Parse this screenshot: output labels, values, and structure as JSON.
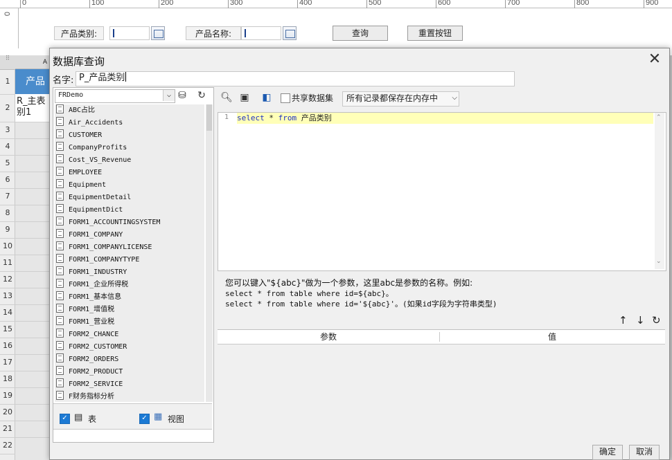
{
  "ruler": {
    "numbers": [
      "0",
      "100",
      "200",
      "300",
      "400",
      "500",
      "600",
      "700",
      "800",
      "900"
    ],
    "left_number": "0"
  },
  "form": {
    "label1": "产品类别:",
    "label2": "产品名称:",
    "query_button": "查询",
    "reset_button": "重置按钮"
  },
  "sheet": {
    "col_header": "A",
    "header_cell": "产品",
    "sub_cell": "R_主表别1",
    "row_numbers": [
      "1",
      "2",
      "3",
      "4",
      "5",
      "6",
      "7",
      "8",
      "9",
      "10",
      "11",
      "12",
      "13",
      "14",
      "15",
      "16",
      "17",
      "18",
      "19",
      "20",
      "21",
      "22"
    ]
  },
  "dialog": {
    "title": "数据库查询",
    "close_icon": "close-icon",
    "name_label": "名字:",
    "name_value": "P_产品类别",
    "datasource": "FRDemo",
    "tables": [
      "ABC占比",
      "Air_Accidents",
      "CUSTOMER",
      "CompanyProfits",
      "Cost_VS_Revenue",
      "EMPLOYEE",
      "Equipment",
      "EquipmentDetail",
      "EquipmentDict",
      "FORM1_ACCOUNTINGSYSTEM",
      "FORM1_COMPANY",
      "FORM1_COMPANYLICENSE",
      "FORM1_COMPANYTYPE",
      "FORM1_INDUSTRY",
      "FORM1_企业所得税",
      "FORM1_基本信息",
      "FORM1_增值税",
      "FORM1_营业税",
      "FORM2_CHANCE",
      "FORM2_CUSTOMER",
      "FORM2_ORDERS",
      "FORM2_PRODUCT",
      "FORM2_SERVICE",
      "F财务指标分析"
    ],
    "filter_table": "表",
    "filter_view": "视图",
    "share_label": "共享数据集",
    "storage_option": "所有记录都保存在内存中",
    "sql": {
      "line_no": "1",
      "kw1": "select",
      "star": " * ",
      "kw2": "from",
      "table": " 产品类别"
    },
    "hint1": "您可以键入\"${abc}\"做为一个参数，这里abc是参数的名称。例如:",
    "hint2": "select * from table where id=${abc}。",
    "hint3": "select * from table where id='${abc}'。(如果id字段为字符串类型)",
    "param_col": "参数",
    "value_col": "值",
    "ok": "确定",
    "cancel": "取消"
  },
  "colors": {
    "accent": "#1c7ad4",
    "header_blue": "#4a8ccc",
    "sql_highlight": "#ffffb8",
    "keyword": "#1c2fc2"
  }
}
